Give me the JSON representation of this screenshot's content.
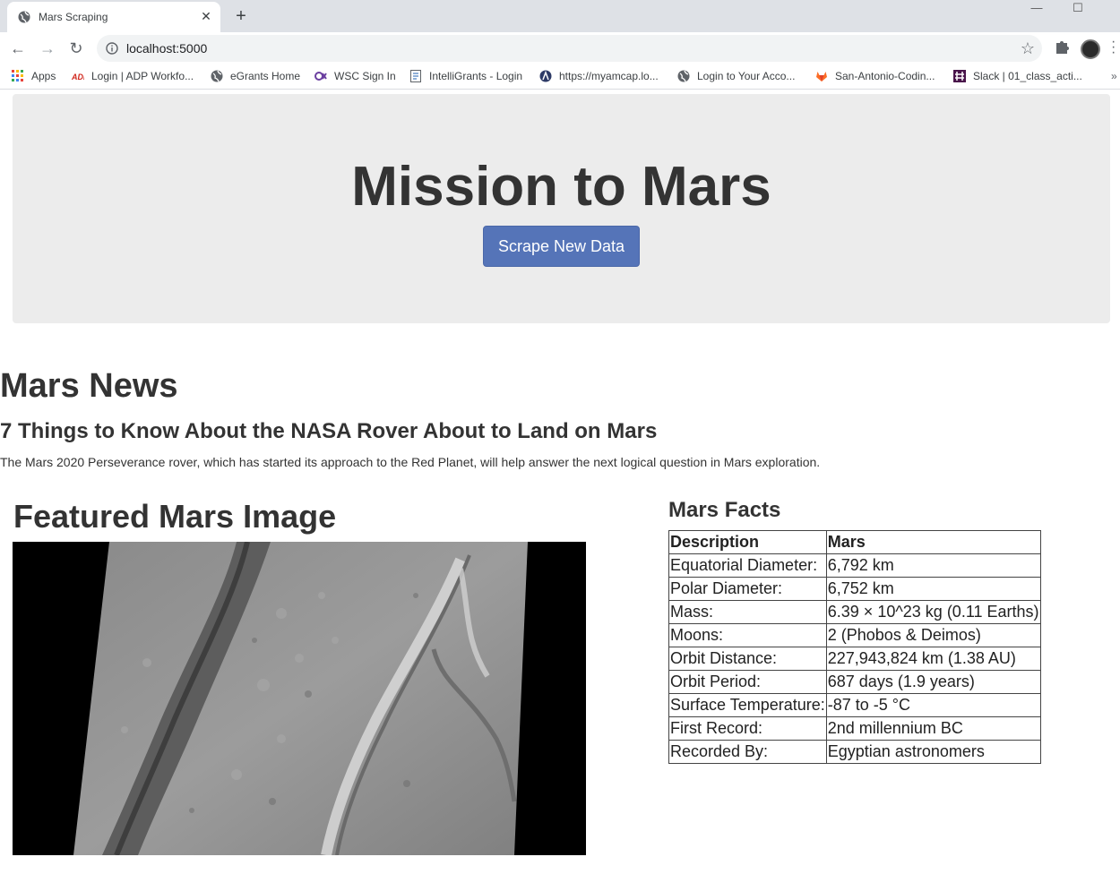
{
  "browser": {
    "tab_title": "Mars Scraping",
    "url": "localhost:5000",
    "bookmarks": [
      {
        "label": "Apps",
        "icon": "apps-grid-icon"
      },
      {
        "label": "Login | ADP Workfo...",
        "icon": "adp-icon"
      },
      {
        "label": "eGrants Home",
        "icon": "globe-icon"
      },
      {
        "label": "WSC Sign In",
        "icon": "wsc-icon"
      },
      {
        "label": "IntelliGrants - Login",
        "icon": "page-icon"
      },
      {
        "label": "https://myamcap.lo...",
        "icon": "amcap-icon"
      },
      {
        "label": "Login to Your Acco...",
        "icon": "globe-icon"
      },
      {
        "label": "San-Antonio-Codin...",
        "icon": "gitlab-icon"
      },
      {
        "label": "Slack | 01_class_acti...",
        "icon": "slack-icon"
      }
    ],
    "more_bookmarks": "»"
  },
  "jumbotron": {
    "title": "Mission to Mars",
    "button_label": "Scrape New Data"
  },
  "news": {
    "heading": "Mars News",
    "title": "7 Things to Know About the NASA Rover About to Land on Mars",
    "paragraph": "The Mars 2020 Perseverance rover, which has started its approach to the Red Planet, will help answer the next logical question in Mars exploration."
  },
  "featured_image": {
    "heading": "Featured Mars Image"
  },
  "facts": {
    "heading": "Mars Facts",
    "columns": [
      "Description",
      "Mars"
    ],
    "rows": [
      [
        "Equatorial Diameter:",
        "6,792 km"
      ],
      [
        "Polar Diameter:",
        "6,752 km"
      ],
      [
        "Mass:",
        "6.39 × 10^23 kg (0.11 Earths)"
      ],
      [
        "Moons:",
        "2 (Phobos & Deimos)"
      ],
      [
        "Orbit Distance:",
        "227,943,824 km (1.38 AU)"
      ],
      [
        "Orbit Period:",
        "687 days (1.9 years)"
      ],
      [
        "Surface Temperature:",
        "-87 to -5 °C"
      ],
      [
        "First Record:",
        "2nd millennium BC"
      ],
      [
        "Recorded By:",
        "Egyptian astronomers"
      ]
    ]
  }
}
